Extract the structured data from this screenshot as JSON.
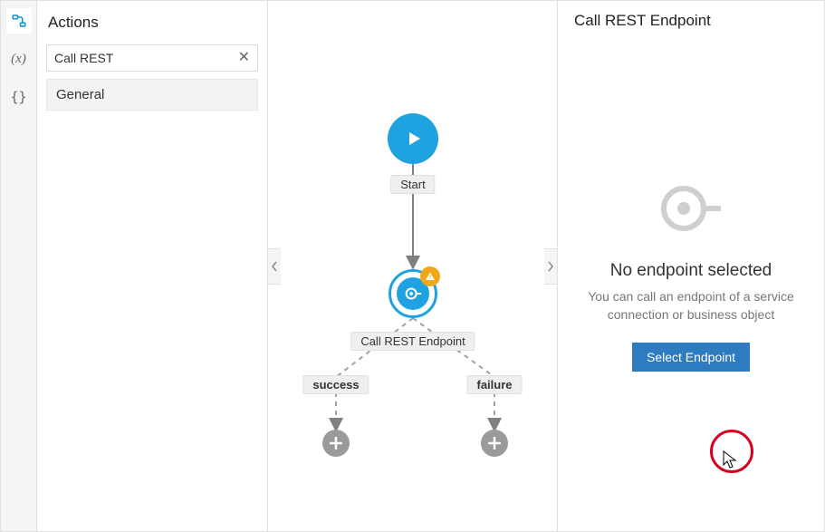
{
  "rail": {
    "items": [
      {
        "name": "flow-icon"
      },
      {
        "name": "variables-icon"
      },
      {
        "name": "types-icon"
      }
    ]
  },
  "sidebar": {
    "title": "Actions",
    "search_value": "Call REST",
    "category_label": "General"
  },
  "canvas": {
    "start_label": "Start",
    "action_label": "Call REST Endpoint",
    "outcome_success": "success",
    "outcome_failure": "failure"
  },
  "details": {
    "title": "Call REST Endpoint",
    "empty_heading": "No endpoint selected",
    "empty_text": "You can call an endpoint of a service connection or business object",
    "button_label": "Select Endpoint"
  }
}
